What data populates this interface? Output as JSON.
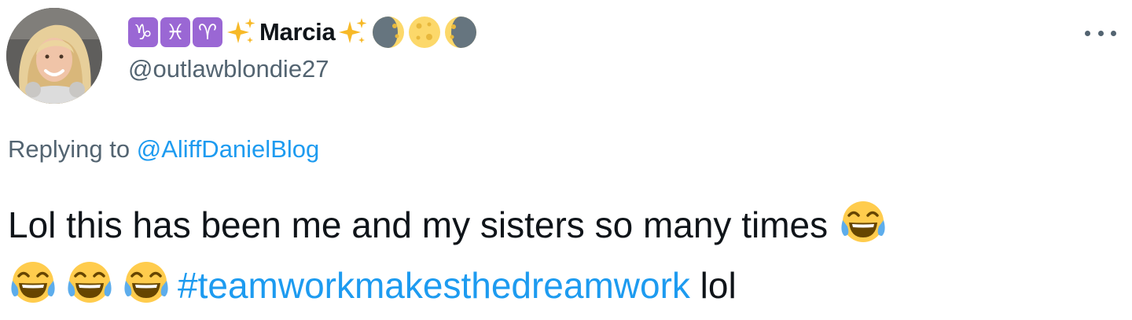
{
  "user": {
    "zodiac_icons": [
      "♑",
      "♓",
      "♈"
    ],
    "display_name": "Marcia",
    "handle": "@outlawblondie27"
  },
  "reply": {
    "prefix": "Replying to ",
    "mention": "@AliffDanielBlog"
  },
  "tweet": {
    "text": "Lol this has been me and my sisters so many times ",
    "hashtag": "#teamworkmakesthedreamwork",
    "suffix": " lol",
    "emoji": "face-with-tears-of-joy"
  },
  "colors": {
    "link": "#1d9bf0",
    "secondary_text": "#536471",
    "primary_text": "#0f1419",
    "zodiac_bg": "#9a67d4"
  }
}
